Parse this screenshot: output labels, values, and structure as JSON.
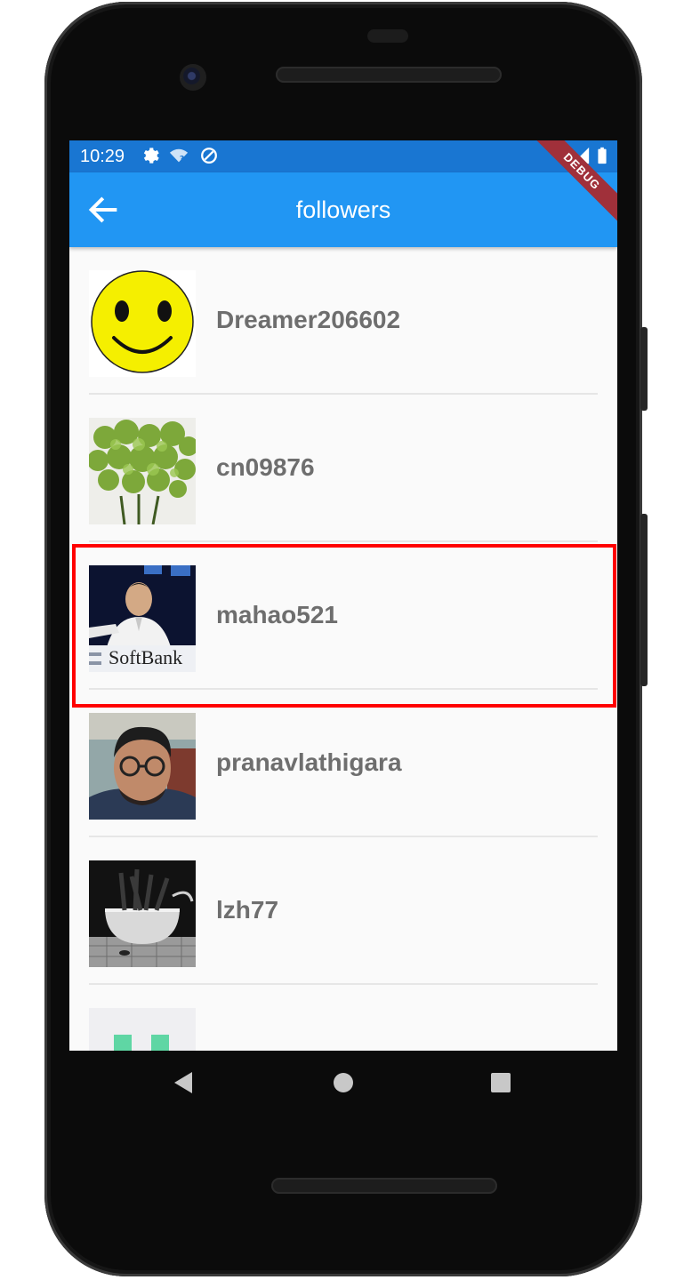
{
  "status_bar": {
    "time": "10:29",
    "icons": [
      "gear-icon",
      "wifi-question-icon",
      "data-saver-icon",
      "wifi-off-icon",
      "signal-icon",
      "battery-icon"
    ]
  },
  "app_bar": {
    "title": "followers",
    "back_icon": "arrow-left-icon",
    "debug_banner": "DEBUG"
  },
  "followers": [
    {
      "username": "Dreamer206602",
      "avatar": "smiley-face"
    },
    {
      "username": "cn09876",
      "avatar": "green-flowers"
    },
    {
      "username": "mahao521",
      "avatar": "softbank-speaker",
      "avatar_text": "SoftBank"
    },
    {
      "username": "pranavlathigara",
      "avatar": "man-with-glasses"
    },
    {
      "username": "lzh77",
      "avatar": "bathtub-photo"
    },
    {
      "username": "",
      "avatar": "green-identicon"
    }
  ],
  "nav_bar": {
    "icons": [
      "back-triangle-icon",
      "home-circle-icon",
      "recents-square-icon"
    ]
  },
  "colors": {
    "status_bar": "#1976d2",
    "app_bar": "#2196f3",
    "highlight": "#ff0000",
    "username": "#6e6e6e"
  }
}
